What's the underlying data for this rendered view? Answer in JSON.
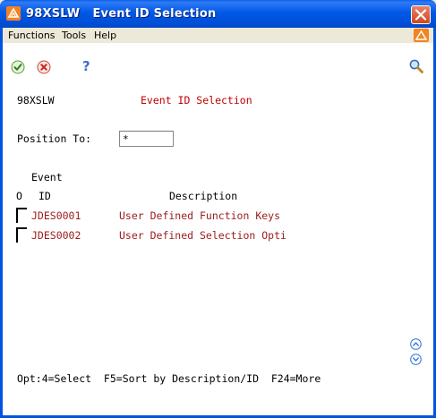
{
  "window": {
    "title": "98XSLW   Event ID Selection"
  },
  "menu": {
    "items": [
      "Functions",
      "Tools",
      "Help"
    ]
  },
  "toolbar": {
    "icons": [
      "ok-check-icon",
      "cancel-x-icon",
      "help-question-icon",
      "search-magnifier-icon"
    ]
  },
  "screen": {
    "program_id": "98XSLW",
    "title": "Event ID Selection",
    "position_label": "Position To:",
    "position_value": "*",
    "header_event": "Event",
    "header_o": "O",
    "header_id": "ID",
    "header_description": "Description",
    "rows": [
      {
        "option": "",
        "id": "JDES0001",
        "description": "User Defined Function Keys"
      },
      {
        "option": "",
        "id": "JDES0002",
        "description": "User Defined Selection Opti"
      }
    ],
    "footer": "Opt:4=Select  F5=Sort by Description/ID  F24=More"
  },
  "colors": {
    "title_bar": "#0054E3",
    "screen_title": "#C00000",
    "row_text": "#9B1B1B",
    "chrome": "#ECE9D8"
  }
}
